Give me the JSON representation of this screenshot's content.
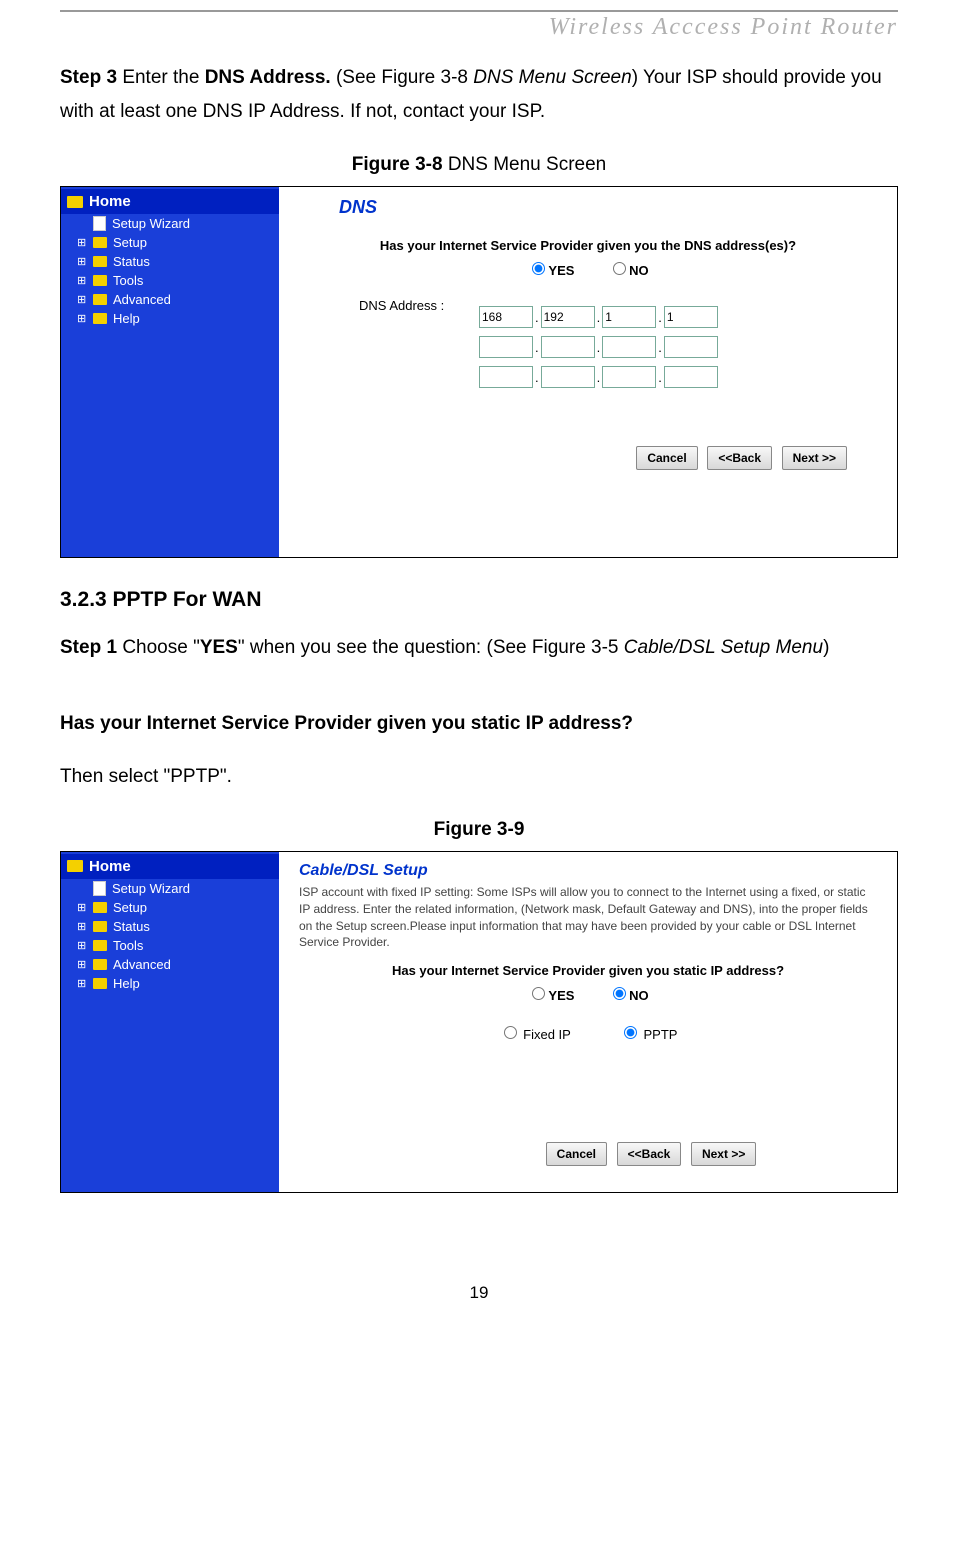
{
  "header": "Wireless  Acccess  Point  Router",
  "step3": {
    "prefix": "Step 3 ",
    "text1": "Enter the ",
    "bold1": "DNS Address. ",
    "text2": "(See Figure 3-8 ",
    "italic1": "DNS Menu Screen",
    "text3": ") Your ISP should provide you with at least one DNS IP Address. If not, contact your ISP."
  },
  "fig38_caption_bold": "Figure 3-8 ",
  "fig38_caption_rest": "DNS Menu Screen",
  "sidebar": {
    "home": "Home",
    "items": [
      "Setup Wizard",
      "Setup",
      "Status",
      "Tools",
      "Advanced",
      "Help"
    ]
  },
  "fig38": {
    "title": "DNS",
    "question": "Has your Internet Service Provider given you the DNS address(es)?",
    "yes": "YES",
    "no": "NO",
    "dns_label": "DNS Address :",
    "dns1": [
      "168",
      "192",
      "1",
      "1"
    ],
    "cancel": "Cancel",
    "back": "<<Back",
    "next": "Next >>"
  },
  "section_heading": "3.2.3 PPTP For WAN",
  "step1": {
    "prefix": "Step 1 ",
    "text1": "Choose \"",
    "bold1": "YES",
    "text2": "\" when you see the question: (See Figure 3-5 ",
    "italic1": "Cable/DSL Setup Menu",
    "text3": ")"
  },
  "question_bold": "Has your Internet Service Provider given you static IP address?",
  "then_select": "Then select \"PPTP\".",
  "fig39_caption": "Figure 3-9",
  "fig39": {
    "title": "Cable/DSL Setup",
    "desc": "ISP account with fixed IP setting: Some ISPs will allow you to connect to the Internet using a fixed, or static IP address. Enter the related information, (Network mask, Default Gateway and DNS), into the proper fields on the Setup screen.Please input information that may have been provided by your cable or DSL Internet Service Provider.",
    "question": "Has your Internet Service Provider given you static IP address?",
    "yes": "YES",
    "no": "NO",
    "fixed": "Fixed IP",
    "pptp": "PPTP",
    "cancel": "Cancel",
    "back": "<<Back",
    "next": "Next >>"
  },
  "page_number": "19"
}
